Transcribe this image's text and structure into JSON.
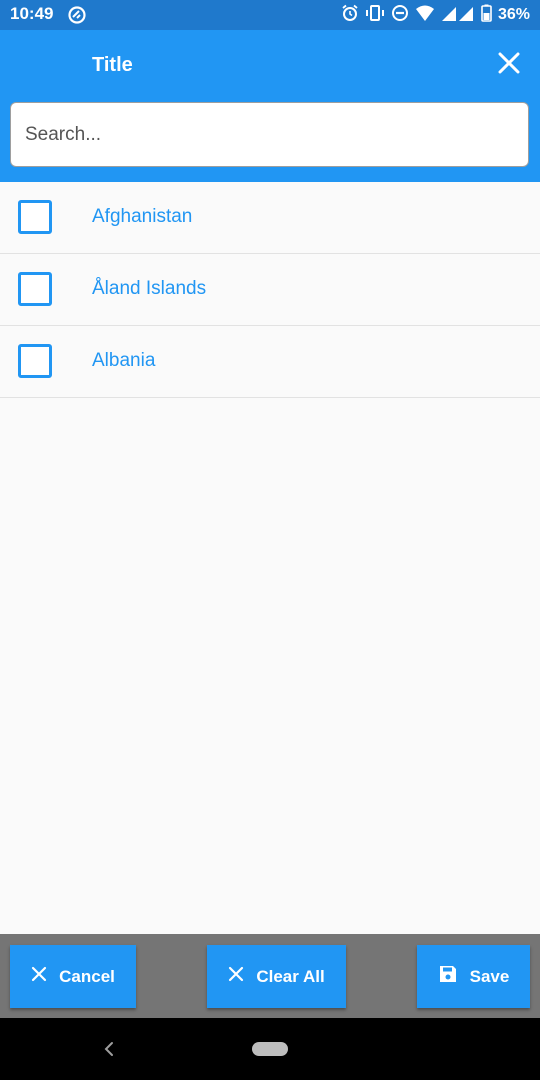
{
  "status_bar": {
    "time": "10:49",
    "battery_percent": "36%",
    "icons": [
      "alarm-icon",
      "vibrate-icon",
      "do-not-disturb-icon",
      "wifi-icon",
      "signal-icon",
      "battery-icon"
    ]
  },
  "header": {
    "title": "Title",
    "close_icon": "close-icon"
  },
  "search": {
    "placeholder": "Search..."
  },
  "list": {
    "items": [
      {
        "label": "Afghanistan",
        "checked": false
      },
      {
        "label": "Åland Islands",
        "checked": false
      },
      {
        "label": "Albania",
        "checked": false
      }
    ]
  },
  "actions": {
    "cancel_label": "Cancel",
    "clear_all_label": "Clear All",
    "save_label": "Save"
  },
  "colors": {
    "primary": "#2196f3",
    "status_bar": "#1f79cc",
    "bottom_bar": "#757575"
  }
}
